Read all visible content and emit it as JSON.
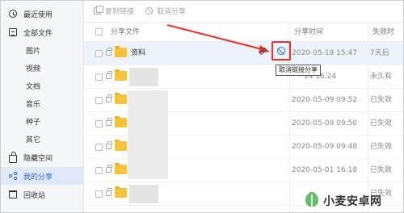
{
  "sidebar": {
    "items": [
      {
        "label": "最近使用",
        "icon": "clock-icon"
      },
      {
        "label": "全部文件",
        "icon": "document-icon"
      },
      {
        "label": "图片"
      },
      {
        "label": "视频"
      },
      {
        "label": "文档"
      },
      {
        "label": "音乐"
      },
      {
        "label": "种子"
      },
      {
        "label": "其它"
      },
      {
        "label": "隐藏空间",
        "icon": "lock-icon"
      },
      {
        "label": "我的分享",
        "icon": "share-icon",
        "active": true
      },
      {
        "label": "回收站",
        "icon": "trash-icon"
      }
    ]
  },
  "toolbar": {
    "copy_link_label": "复制链接",
    "cancel_share_label": "取消分享"
  },
  "table": {
    "headers": {
      "name": "分享文件",
      "time": "分享时间",
      "status": "失效时"
    },
    "rows": [
      {
        "name": "资料",
        "time": "2020-05-19 15:47",
        "status": "7天后"
      },
      {
        "name": "",
        "time": "2020-05-14 16:24",
        "status": "永久有"
      },
      {
        "name": "",
        "time": "2020-05-09 09:52",
        "status": "已失效"
      },
      {
        "name": "",
        "time": "2020-05-09 09:50",
        "status": "已失效"
      },
      {
        "name": "",
        "time": "2020-05-09 09:48",
        "status": "已失效"
      },
      {
        "name": "",
        "time": "2020-05-01 16:18",
        "status": "已失效"
      },
      {
        "name": "",
        "time": "",
        "status": "已失效"
      }
    ]
  },
  "tooltip": "取消链接分享",
  "watermark": "小麦安卓网",
  "colors": {
    "accent": "#2d6ec9",
    "highlight": "#e8302a",
    "folder": "#f7c33f"
  }
}
